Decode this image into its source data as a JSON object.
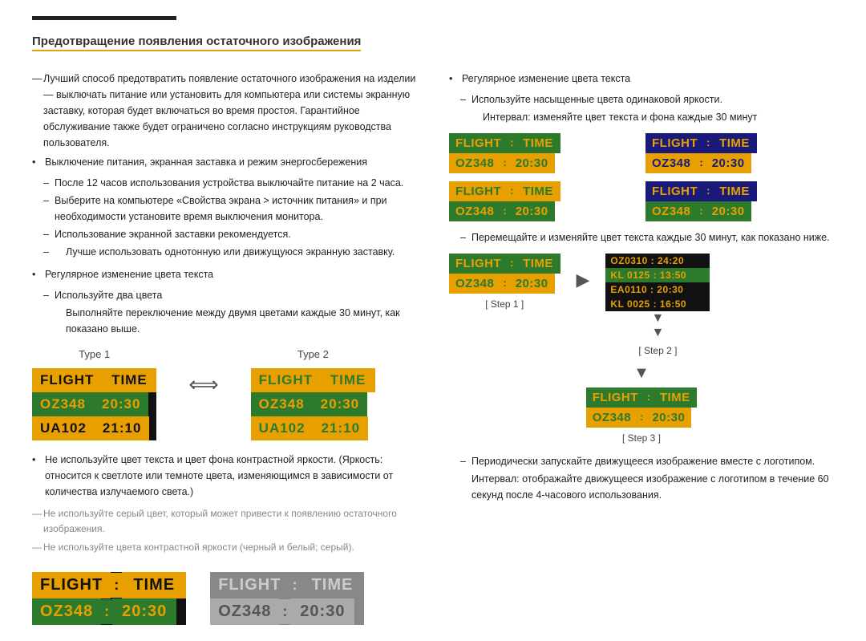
{
  "top_line": true,
  "title": "Предотвращение появления остаточного изображения",
  "intro_paragraph": "Лучший способ предотвратить появление остаточного изображения на изделии — выключать питание или установить для компьютера или системы экранную заставку, которая будет включаться во время простоя. Гарантийное обслуживание также будет ограничено согласно инструкциям руководства пользователя.",
  "section1_title": "Выключение питания, экранная заставка и режим энергосбережения",
  "section1_items": [
    "После 12 часов использования устройства выключайте питание на 2 часа.",
    "Выберите на компьютере «Свойства экрана > источник питания» и при необходимости установите время выключения монитора.",
    "Использование экранной заставки рекомендуется.",
    "Лучше использовать однотонную или движущуюся экранную заставку."
  ],
  "section2_title": "Регулярное изменение цвета текста",
  "section2_sub1": "Используйте два цвета",
  "section2_sub1_text": "Выполняйте переключение между двумя цветами каждые 30 минут, как показано выше.",
  "type1_label": "Type 1",
  "type2_label": "Type 2",
  "flight_label": "FLIGHT",
  "time_label": "TIME",
  "oz348_label": "OZ348",
  "time1": "20:30",
  "ua102_label": "UA102",
  "time2": "21:10",
  "colon": ":",
  "section3_bullet": "Не используйте цвет текста и цвет фона контрастной яркости. (Яркость: относится к светлоте или темноте цвета, изменяющимся в зависимости от количества излучаемого света.)",
  "section4_dash": "Не используйте серый цвет, который может привести к появлению остаточного изображения.",
  "section5_dash": "Не используйте цвета контрастной яркости (черный и белый; серый).",
  "right_section_title": "Регулярное изменение цвета текста",
  "right_sub1": "Используйте насыщенные цвета одинаковой яркости.",
  "right_sub2": "Интервал: изменяйте цвет текста и фона каждые 30 минут",
  "right_sub3": "Перемещайте и изменяйте цвет текста каждые 30 минут, как показано ниже.",
  "step1_label": "[ Step 1 ]",
  "step2_label": "[ Step 2 ]",
  "step3_label": "[ Step 3 ]",
  "step2_data": [
    {
      "text": "OZ0310 : 24:20",
      "class": "orange"
    },
    {
      "text": "KL 0125 : 13:50",
      "class": "highlight"
    },
    {
      "text": "EA0110 : 20:30",
      "class": "orange"
    },
    {
      "text": "KL 0025 : 16:50",
      "class": "orange"
    }
  ],
  "periodic_text1": "Периодически запускайте движущееся изображение вместе с логотипом.",
  "periodic_text2": "Интервал: отображайте движущееся изображение с логотипом в течение 60 секунд после 4-часового использования."
}
